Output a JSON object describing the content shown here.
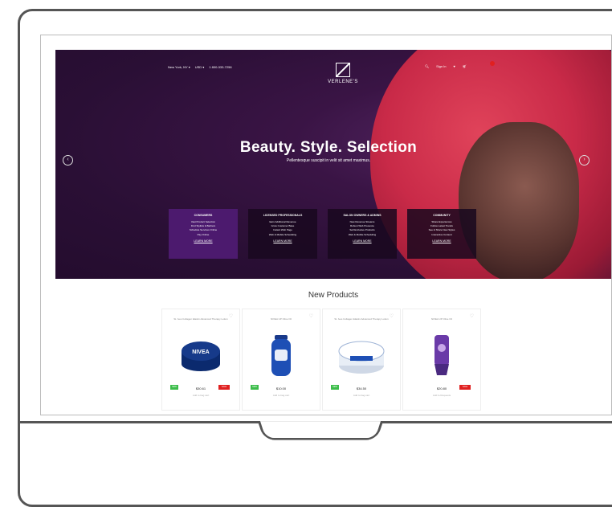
{
  "header": {
    "location": "New York, NY ▾",
    "currency": "USD ▾",
    "phone": "1 800-333-7256",
    "brand": "VERLENE'S",
    "signin": "Sign In",
    "icons": [
      "search-icon",
      "heart-icon",
      "cart-icon"
    ]
  },
  "hero": {
    "headline": "Beauty. Style. Selection",
    "subline": "Pellentesque suscipit in velit sit amet maximus.",
    "cards": [
      {
        "title": "CONSUMERS",
        "items": [
          "Vast Product Selection",
          "Find Stylists & Barbers",
          "Schedule Services Online",
          "Pay Online"
        ],
        "more": "LEARN MORE"
      },
      {
        "title": "LICENSED PROFESSIONALS",
        "items": [
          "Earn Additional Revenue",
          "Grow Customer Base",
          "Instant Web Page",
          "Web & Mobile Scheduling"
        ],
        "more": "LEARN MORE"
      },
      {
        "title": "SALON OWNERS & ADMINS",
        "items": [
          "New Revenue Streams",
          "Robust Web Presence",
          "Sell Exclusive Products",
          "Web & Mobile Scheduling"
        ],
        "more": "LEARN MORE"
      },
      {
        "title": "COMMUNITY",
        "items": [
          "Share Experiences",
          "Follow Latest Trends",
          "See & Share New Styles",
          "Interactive Content"
        ],
        "more": "LEARN MORE"
      }
    ]
  },
  "new_products": {
    "title": "New Products",
    "items": [
      {
        "name": "St. Ives Collagen Elastin Advanced Therapy Lotion",
        "price": "$30.61",
        "new": "NEW",
        "sale": "SALE",
        "add": "Add to bag cart"
      },
      {
        "name": "NIVEA UP Olive Oil",
        "price": "$10.00",
        "new": "NEW",
        "sale": "",
        "add": "Add to bag cart"
      },
      {
        "name": "St. Ives Collagen Elastin Advanced Therapy Lotion",
        "price": "$34.50",
        "new": "NEW",
        "sale": "",
        "add": "Add to bag cart"
      },
      {
        "name": "NIVEA UP Olive Oil",
        "price": "$20.80",
        "new": "",
        "sale": "SALE",
        "add": "Add to Requests"
      }
    ]
  }
}
